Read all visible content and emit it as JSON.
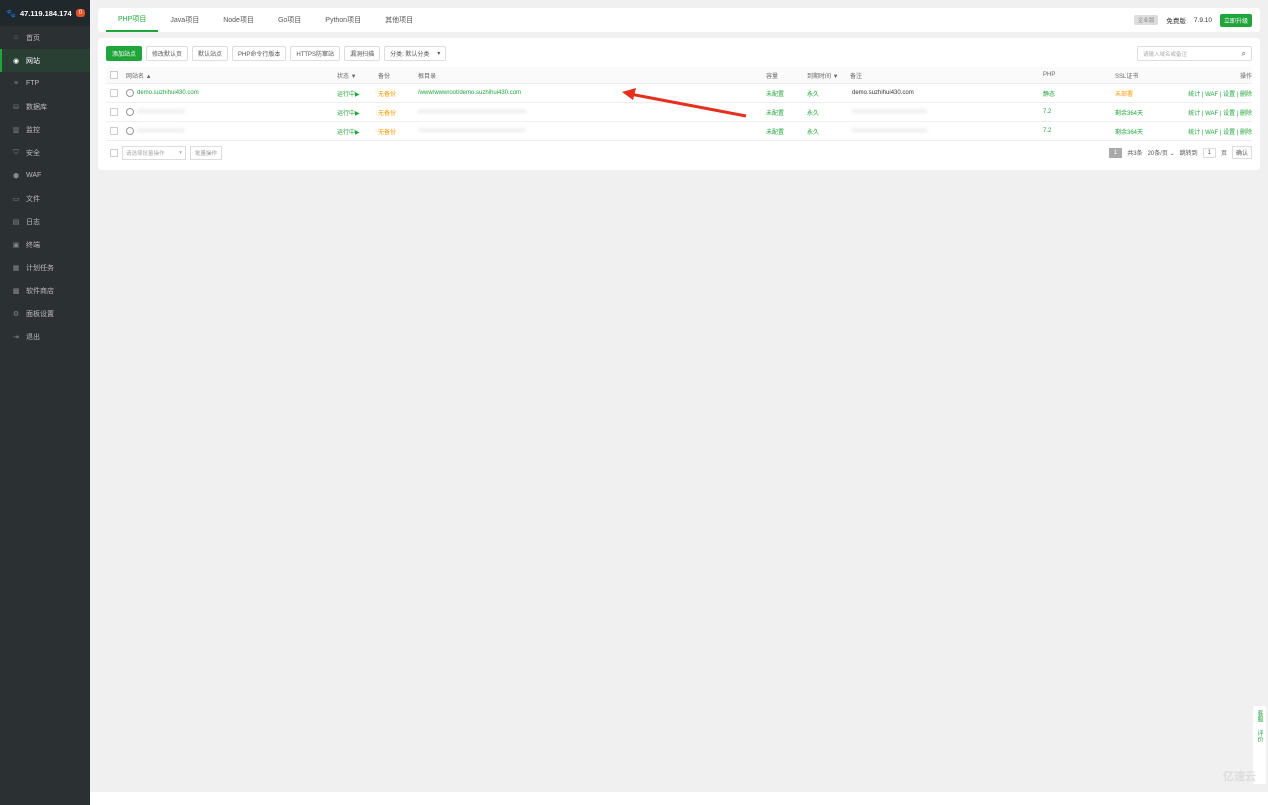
{
  "sidebar": {
    "ip": "47.119.184.174",
    "badge": "0",
    "items": [
      {
        "label": "首页",
        "icon": "home-icon",
        "glyph": "⌂"
      },
      {
        "label": "网站",
        "icon": "globe-icon",
        "glyph": "◉",
        "active": true
      },
      {
        "label": "FTP",
        "icon": "ftp-icon",
        "glyph": "≡"
      },
      {
        "label": "数据库",
        "icon": "database-icon",
        "glyph": "⛁"
      },
      {
        "label": "监控",
        "icon": "monitor-icon",
        "glyph": "▥"
      },
      {
        "label": "安全",
        "icon": "shield-icon",
        "glyph": "⛉"
      },
      {
        "label": "WAF",
        "icon": "waf-icon",
        "glyph": "⬢"
      },
      {
        "label": "文件",
        "icon": "folder-icon",
        "glyph": "▭"
      },
      {
        "label": "日志",
        "icon": "log-icon",
        "glyph": "▤"
      },
      {
        "label": "终端",
        "icon": "terminal-icon",
        "glyph": "▣"
      },
      {
        "label": "计划任务",
        "icon": "calendar-icon",
        "glyph": "▦"
      },
      {
        "label": "软件商店",
        "icon": "grid-icon",
        "glyph": "▩"
      },
      {
        "label": "面板设置",
        "icon": "gear-icon",
        "glyph": "⚙"
      },
      {
        "label": "退出",
        "icon": "logout-icon",
        "glyph": "⇥"
      }
    ]
  },
  "tabs": [
    {
      "label": "PHP项目",
      "active": true
    },
    {
      "label": "Java项目"
    },
    {
      "label": "Node项目"
    },
    {
      "label": "Go项目"
    },
    {
      "label": "Python项目"
    },
    {
      "label": "其他项目"
    }
  ],
  "top_right": {
    "enterprise": "企业版",
    "edition": "免费版",
    "version": "7.9.10",
    "upgrade": "立即升级"
  },
  "toolbar": {
    "add_site": "添加站点",
    "edit_default_page": "修改默认页",
    "default_site": "默认站点",
    "php_cli_version": "PHP命令行版本",
    "https_defense": "HTTPS防窜站",
    "vuln_scan": "漏洞扫描",
    "category": "分类: 默认分类",
    "search_placeholder": "请输入域名或备注"
  },
  "table": {
    "headers": {
      "site_name": "网站名 ▲",
      "status": "状态 ▼",
      "backup": "备份",
      "root": "根目录",
      "capacity": "容量",
      "expire": "到期时间 ▼",
      "remark": "备注",
      "php": "PHP",
      "ssl": "SSL证书",
      "actions": "操作"
    },
    "rows": [
      {
        "name": "demo.suzhihui430.com",
        "status": "运行中▶",
        "backup": "无备份",
        "root": "/www/wwwroot/demo.suzhihui430.com",
        "capacity": "未配置",
        "expire": "永久",
        "remark": "demo.suzhihui430.com",
        "php": "静态",
        "ssl": "未部署",
        "ssl_color": "#ff9900",
        "actions": "统计 | WAF | 设置 | 删除"
      },
      {
        "name": "",
        "status": "运行中▶",
        "backup": "无备份",
        "root": "",
        "capacity": "未配置",
        "expire": "永久",
        "remark": "",
        "php": "7.2",
        "ssl": "剩余364天",
        "ssl_color": "#20a53a",
        "actions": "统计 | WAF | 设置 | 删除"
      },
      {
        "name": "",
        "status": "运行中▶",
        "backup": "无备份",
        "root": "",
        "capacity": "未配置",
        "expire": "永久",
        "remark": "",
        "php": "7.2",
        "ssl": "剩余364天",
        "ssl_color": "#20a53a",
        "actions": "统计 | WAF | 设置 | 删除"
      }
    ]
  },
  "batch": {
    "select_placeholder": "请选择批量操作",
    "button": "批量操作"
  },
  "pager": {
    "page": "1",
    "total": "共3条",
    "per_page": "20条/页",
    "jump_label": "跳转到",
    "jump_value": "1",
    "page_unit": "页",
    "confirm": "确认"
  },
  "side_float": {
    "service": "客服",
    "review": "评价"
  },
  "watermark": "亿速云"
}
